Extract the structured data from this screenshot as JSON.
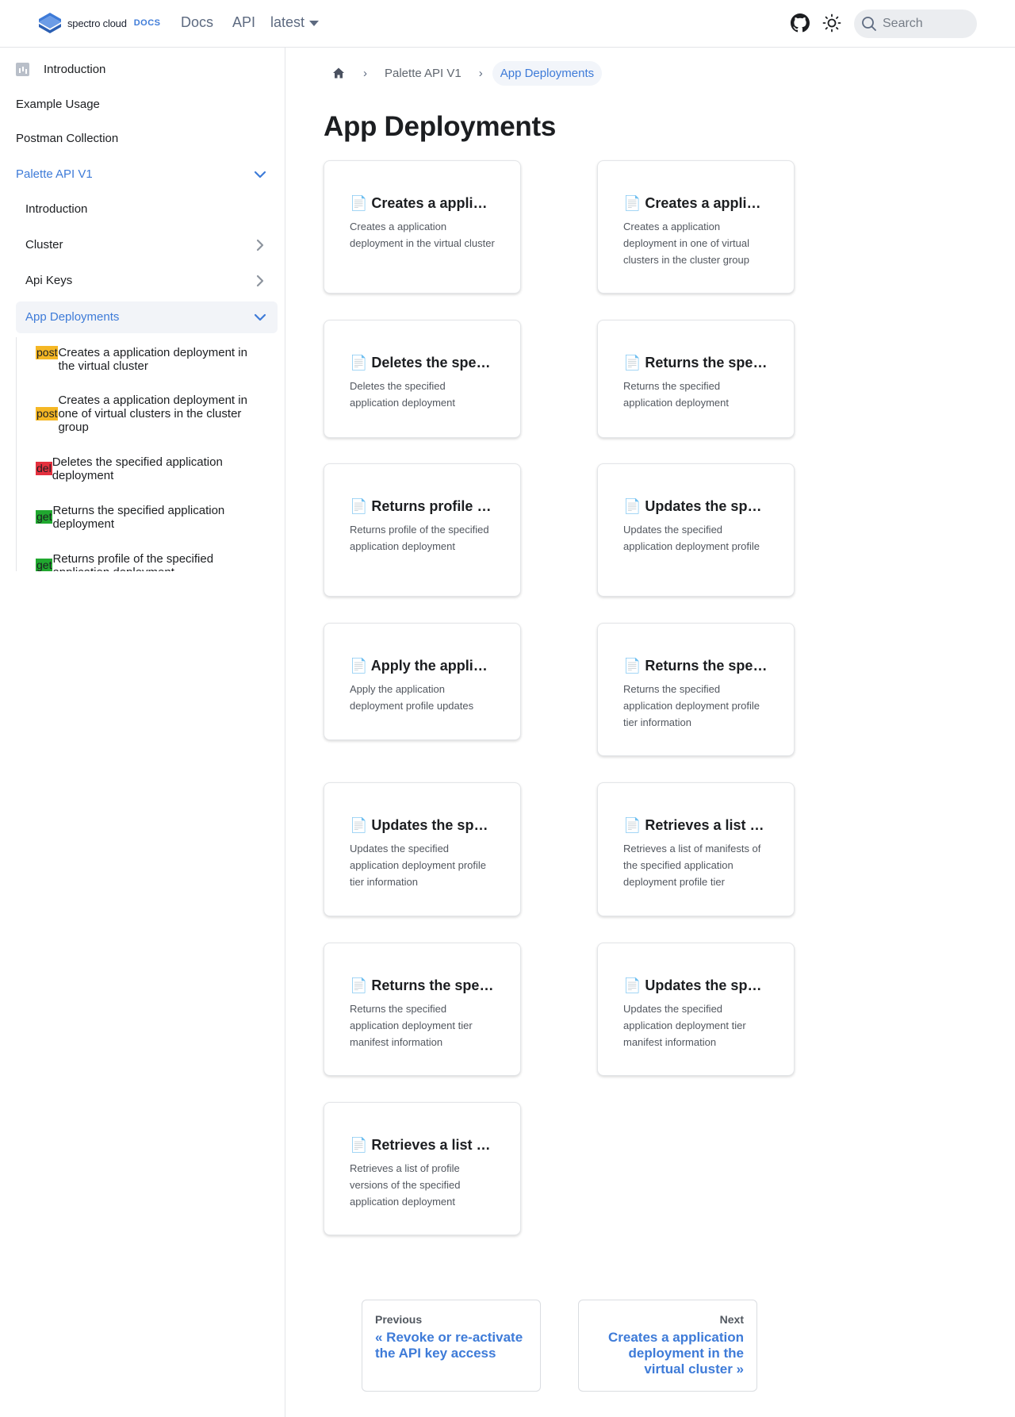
{
  "navbar": {
    "logo_text": "spectro cloud",
    "logo_badge": "DOCS",
    "links": [
      "Docs",
      "API"
    ],
    "version": "latest",
    "search_placeholder": "Search"
  },
  "sidebar": {
    "top_items": [
      "Introduction",
      "Example Usage",
      "Postman Collection"
    ],
    "category": "Palette API V1",
    "sub_items": [
      "Introduction",
      "Cluster",
      "Api Keys",
      "App Deployments"
    ],
    "methods": [
      {
        "method": "post",
        "label": "Creates a application deployment in the virtual cluster"
      },
      {
        "method": "post",
        "label": "Creates a application deployment in one of virtual clusters in the cluster group"
      },
      {
        "method": "del",
        "label": "Deletes the specified application deployment"
      },
      {
        "method": "get",
        "label": "Returns the specified application deployment"
      },
      {
        "method": "get",
        "label": "Returns profile of the specified application deployment"
      }
    ]
  },
  "breadcrumbs": {
    "parent": "Palette API V1",
    "current": "App Deployments"
  },
  "page": {
    "title": "App Deployments"
  },
  "cards": [
    {
      "title": "📄 Creates a application deployment in the virtual cluster",
      "desc": "Creates a application deployment in the virtual cluster"
    },
    {
      "title": "📄 Creates a application deployment in one of virtual clusters in the cluster group",
      "desc": "Creates a application deployment in one of virtual clusters in the cluster group"
    },
    {
      "title": "📄 Deletes the specified application deployment",
      "desc": "Deletes the specified application deployment"
    },
    {
      "title": "📄 Returns the specified application deployment",
      "desc": "Returns the specified application deployment"
    },
    {
      "title": "📄 Returns profile of the specified application deployment",
      "desc": "Returns profile of the specified application deployment"
    },
    {
      "title": "📄 Updates the specified application deployment profile",
      "desc": "Updates the specified application deployment profile"
    },
    {
      "title": "📄 Apply the application deployment profile updates",
      "desc": "Apply the application deployment profile updates"
    },
    {
      "title": "📄 Returns the specified application deployment profile tier information",
      "desc": "Returns the specified application deployment profile tier information"
    },
    {
      "title": "📄 Updates the specified application deployment profile tier information",
      "desc": "Updates the specified application deployment profile tier information"
    },
    {
      "title": "📄 Retrieves a list of manifests of the specified application deployment profile tier",
      "desc": "Retrieves a list of manifests of the specified application deployment profile tier"
    },
    {
      "title": "📄 Returns the specified application deployment tier manifest information",
      "desc": "Returns the specified application deployment tier manifest information"
    },
    {
      "title": "📄 Updates the specified application deployment tier manifest information",
      "desc": "Updates the specified application deployment tier manifest information"
    },
    {
      "title": "📄 Retrieves a list of profile versions of the specified application deployment",
      "desc": "Retrieves a list of profile versions of the specified application deployment"
    }
  ],
  "pagination": {
    "prev_sub": "Previous",
    "prev_label": "« Revoke or re-activate the API key access",
    "next_sub": "Next",
    "next_label": "Creates a application deployment in the virtual cluster »"
  },
  "colors": {
    "accent": "#3e7bd8",
    "post": "#f5b724",
    "del": "#e4303e",
    "get": "#20a82f"
  }
}
